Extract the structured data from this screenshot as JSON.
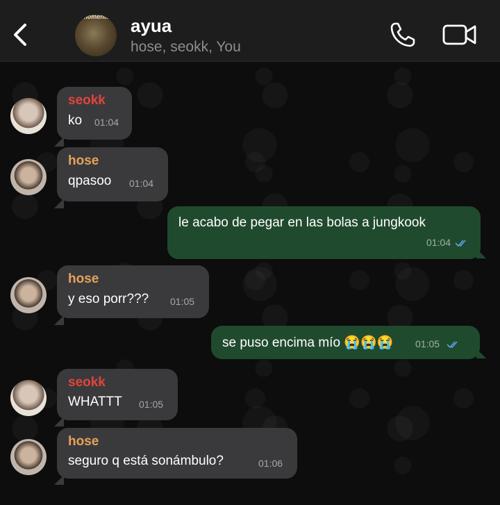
{
  "header": {
    "title": "ayua",
    "subtitle": "hose, seokk, You",
    "avatar_caption": "momento"
  },
  "messages": [
    {
      "sender": "seokk",
      "text": "ko",
      "time": "01:04",
      "direction": "in"
    },
    {
      "sender": "hose",
      "text": "qpasoo",
      "time": "01:04",
      "direction": "in"
    },
    {
      "text": "le acabo de pegar en las bolas a jungkook",
      "time": "01:04",
      "direction": "out",
      "status": "read"
    },
    {
      "sender": "hose",
      "text": "y eso porr???",
      "time": "01:05",
      "direction": "in"
    },
    {
      "text": "se puso encima mío 😭😭😭",
      "time": "01:05",
      "direction": "out",
      "status": "read"
    },
    {
      "sender": "seokk",
      "text": "WHATTT",
      "time": "01:05",
      "direction": "in"
    },
    {
      "sender": "hose",
      "text": "seguro q está sonámbulo?",
      "time": "01:06",
      "direction": "in"
    }
  ],
  "icons": {
    "back": "chevron-left-icon",
    "call": "phone-icon",
    "video": "video-camera-icon",
    "read": "double-check-icon"
  },
  "colors": {
    "incoming_bubble": "#3a3a3c",
    "outgoing_bubble": "#204a2e",
    "sender_seokk": "#e2443b",
    "sender_hose": "#e6a25a",
    "read_ticks": "#5aa5e6"
  }
}
